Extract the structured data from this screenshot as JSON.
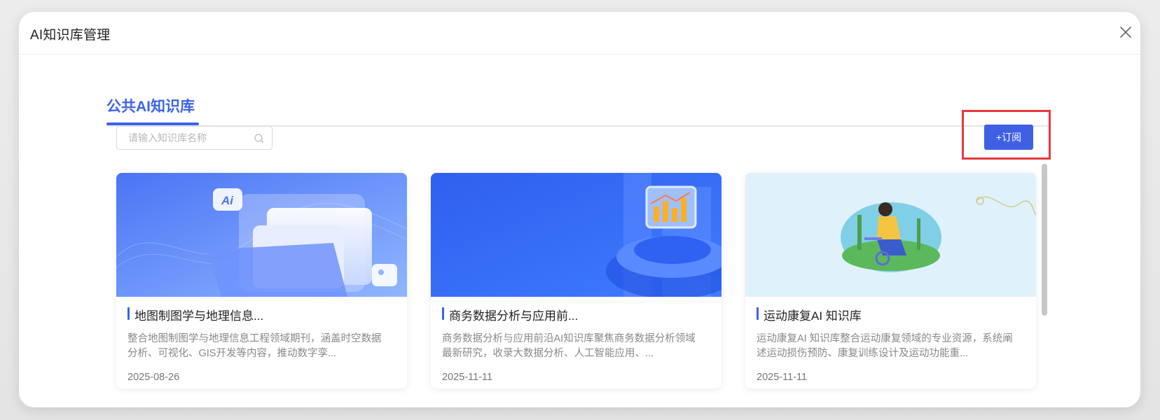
{
  "dialog": {
    "title": "AI知识库管理"
  },
  "tabs": [
    {
      "label": "公共AI知识库",
      "active": true
    }
  ],
  "search": {
    "placeholder": "请输入知识库名称",
    "value": ""
  },
  "toolbar": {
    "subscribe_label": "+订阅"
  },
  "colors": {
    "accent": "#3c63e8",
    "highlight": "#e5383b"
  },
  "cards": [
    {
      "title": "地图制图学与地理信息...",
      "description": "整合地图制图学与地理信息工程领域期刊，涵盖时空数据分析、可视化、GIS开发等内容，推动数字孪...",
      "date": "2025-08-26",
      "image": "ai-folder-illustration"
    },
    {
      "title": "商务数据分析与应用前...",
      "description": "商务数据分析与应用前沿AI知识库聚焦商务数据分析领域最新研究，收录大数据分析、人工智能应用、...",
      "date": "2025-11-11",
      "image": "data-analytics-illustration"
    },
    {
      "title": "运动康复AI 知识库",
      "description": "运动康复AI 知识库整合运动康复领域的专业资源，系统阐述运动损伤预防、康复训练设计及运动功能重...",
      "date": "2025-11-11",
      "image": "rehab-cycling-illustration"
    }
  ]
}
